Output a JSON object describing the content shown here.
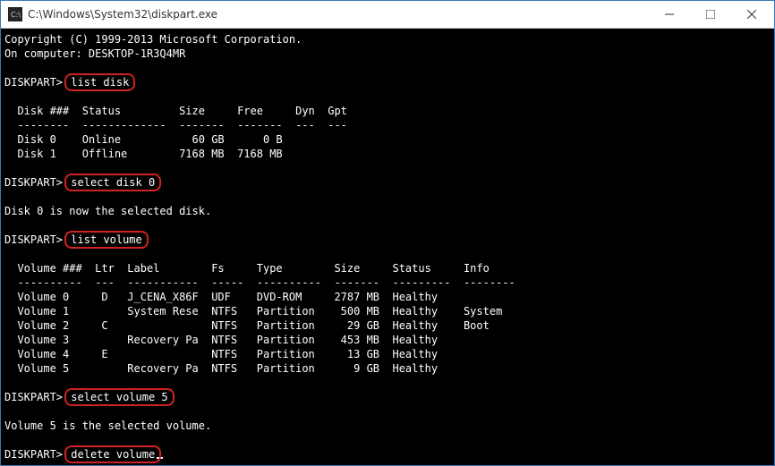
{
  "titlebar": {
    "title": "C:\\Windows\\System32\\diskpart.exe"
  },
  "copyright": "Copyright (C) 1999-2013 Microsoft Corporation.",
  "oncomputer_label": "On computer: ",
  "computer_name": "DESKTOP-1R3Q4MR",
  "prompt": "DISKPART>",
  "cmd1": "list disk",
  "diskheader": "  Disk ###  Status         Size     Free     Dyn  Gpt",
  "diskrule": "  --------  -------------  -------  -------  ---  ---",
  "disk0": "  Disk 0    Online           60 GB      0 B",
  "disk1": "  Disk 1    Offline        7168 MB  7168 MB",
  "cmd2": "select disk 0",
  "msg_selectdisk": "Disk 0 is now the selected disk.",
  "cmd3": "list volume",
  "volheader": "  Volume ###  Ltr  Label        Fs     Type        Size     Status     Info",
  "volrule": "  ----------  ---  -----------  -----  ----------  -------  ---------  --------",
  "vol0": "  Volume 0     D   J_CENA_X86F  UDF    DVD-ROM     2787 MB  Healthy",
  "vol1": "  Volume 1         System Rese  NTFS   Partition    500 MB  Healthy    System",
  "vol2": "  Volume 2     C                NTFS   Partition     29 GB  Healthy    Boot",
  "vol3": "  Volume 3         Recovery Pa  NTFS   Partition    453 MB  Healthy",
  "vol4": "  Volume 4     E                NTFS   Partition     13 GB  Healthy",
  "vol5": "  Volume 5         Recovery Pa  NTFS   Partition      9 GB  Healthy",
  "cmd4": "select volume 5",
  "msg_selectvol": "Volume 5 is the selected volume.",
  "cmd5": "delete volume"
}
